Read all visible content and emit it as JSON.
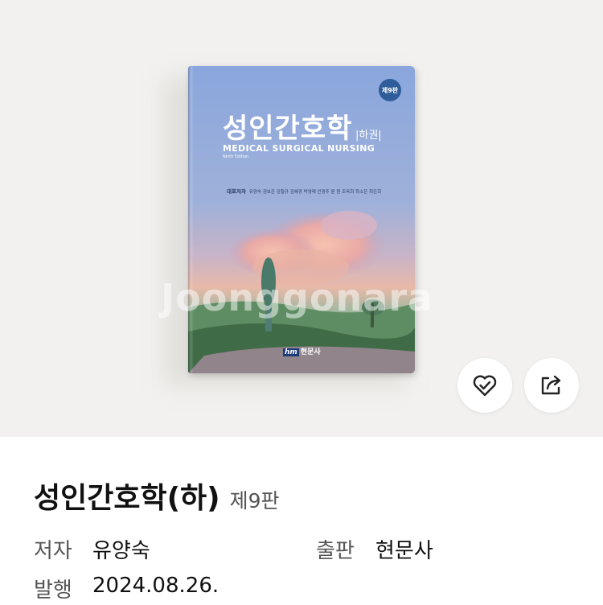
{
  "product": {
    "title": "성인간호학(하)",
    "edition": "제9판",
    "author_label": "저자",
    "author": "유양숙",
    "publisher_label": "출판",
    "publisher": "현문사",
    "date_label": "발행",
    "date": "2024.08.26."
  },
  "cover": {
    "badge": "제9판",
    "title": "성인간호학",
    "subtitle": "|하권|",
    "english_title": "MEDICAL SURGICAL NURSING",
    "english_edition": "Ninth Edition",
    "authors_label": "대표저자",
    "authors": "유양숙 권보은 김철규 김혜경 박영례 안경주 윤 원 조옥희 최소은 최은희",
    "publisher_logo": "hm",
    "publisher_name": "현문사"
  },
  "watermark": "Joonggonara",
  "actions": {
    "wishlist_icon": "heart-check-icon",
    "share_icon": "share-icon"
  },
  "colors": {
    "hero_background": "#f2f1ef",
    "cover_sky": "#8ea8dc"
  }
}
